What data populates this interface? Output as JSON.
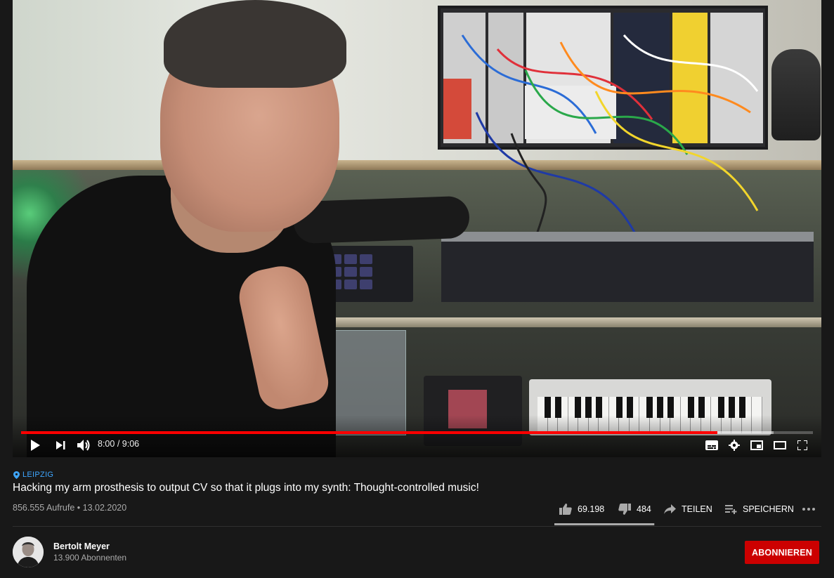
{
  "player": {
    "time_current": "8:00",
    "time_separator": " / ",
    "time_total": "9:06",
    "progress_played": 0.879,
    "progress_buffered": 0.95,
    "icons": [
      "play-icon",
      "next-icon",
      "volume-icon",
      "subtitles-icon",
      "settings-icon",
      "miniplayer-icon",
      "theater-icon",
      "fullscreen-icon"
    ]
  },
  "video": {
    "location": "LEIPZIG",
    "title": "Hacking my arm prosthesis to output CV so that it plugs into my synth: Thought-controlled music!",
    "views": "856.555 Aufrufe",
    "separator": "•",
    "date": "13.02.2020"
  },
  "actions": {
    "likes": "69.198",
    "dislikes": "484",
    "share_label": "TEILEN",
    "save_label": "SPEICHERN",
    "like_ratio": 0.993
  },
  "channel": {
    "name": "Bertolt Meyer",
    "subscribers": "13.900 Abonnenten",
    "subscribe_label": "ABONNIEREN"
  },
  "colors": {
    "background": "#181818",
    "accent_red": "#ff0000",
    "subscribe_red": "#cc0000",
    "link_blue": "#3ea6ff",
    "secondary_text": "#aaaaaa"
  }
}
